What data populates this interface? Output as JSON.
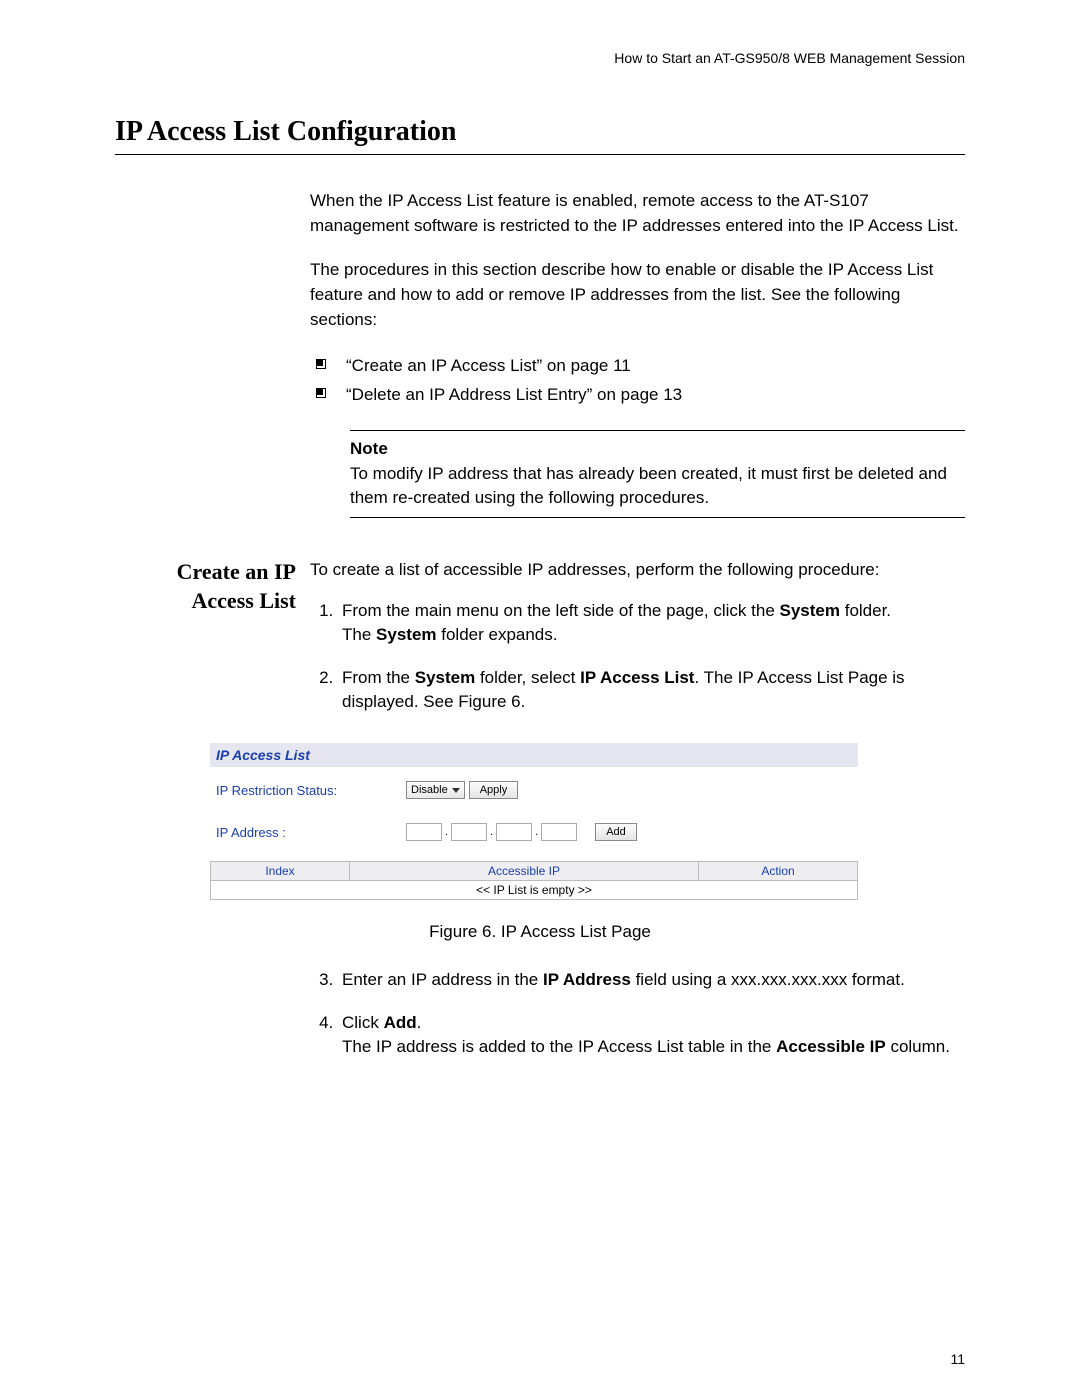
{
  "header": {
    "running_head": "How to Start an AT-GS950/8 WEB Management Session"
  },
  "title": "IP Access List Configuration",
  "intro": {
    "p1": "When the IP Access List feature is enabled, remote access to the AT-S107 management software is restricted to the IP addresses entered into the IP Access List.",
    "p2": "The procedures in this section describe how to enable or disable the IP Access List feature and how to add or remove IP addresses from the list. See the following sections:"
  },
  "bullets": [
    "“Create an IP Access List” on page 11",
    "“Delete an IP Address List Entry” on page 13"
  ],
  "note": {
    "label": "Note",
    "text": "To modify IP address that has already been created, it must first be deleted and them re-created using the following procedures."
  },
  "subsection": {
    "heading": "Create an IP Access List",
    "lead": "To create a list of accessible IP addresses, perform the following procedure:",
    "steps": {
      "s1a": "From the main menu on the left side of the page, click the ",
      "s1_bold1": "System",
      "s1b": " folder.",
      "s1c_a": "The ",
      "s1c_bold": "System",
      "s1c_b": " folder expands.",
      "s2a": "From the ",
      "s2_bold1": "System",
      "s2b": " folder, select ",
      "s2_bold2": "IP Access List",
      "s2c": ". The IP Access List Page is displayed. See Figure 6.",
      "s3a": "Enter an IP address in the ",
      "s3_bold": "IP Address",
      "s3b": " field using a xxx.xxx.xxx.xxx format.",
      "s4a": "Click ",
      "s4_bold1": "Add",
      "s4b": ".",
      "s4c_a": "The IP address is added to the IP Access List table in the ",
      "s4c_bold": "Accessible IP",
      "s4c_b": " column."
    }
  },
  "figure": {
    "ui_title": "IP Access List",
    "status_label": "IP Restriction Status:",
    "status_value": "Disable",
    "apply_btn": "Apply",
    "ip_label": "IP Address :",
    "add_btn": "Add",
    "th_index": "Index",
    "th_ip": "Accessible IP",
    "th_action": "Action",
    "empty_row": "<< IP List is empty >>",
    "caption": "Figure 6. IP Access List Page"
  },
  "page_number": "11"
}
